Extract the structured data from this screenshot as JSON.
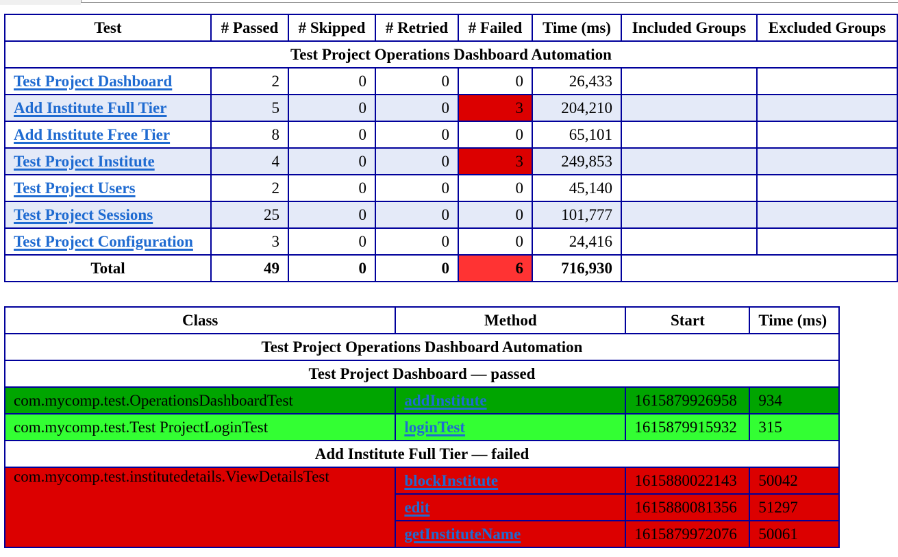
{
  "summary_table": {
    "headers": [
      "Test",
      "# Passed",
      "# Skipped",
      "# Retried",
      "# Failed",
      "Time (ms)",
      "Included Groups",
      "Excluded Groups"
    ],
    "suite_title": "Test Project Operations Dashboard Automation",
    "rows": [
      {
        "test": "Test Project Dashboard",
        "passed": "2",
        "skipped": "0",
        "retried": "0",
        "failed": "0",
        "time": "26,433",
        "included": "",
        "excluded": ""
      },
      {
        "test": "Add Institute Full Tier",
        "passed": "5",
        "skipped": "0",
        "retried": "0",
        "failed": "3",
        "time": "204,210",
        "included": "",
        "excluded": ""
      },
      {
        "test": "Add Institute Free Tier",
        "passed": "8",
        "skipped": "0",
        "retried": "0",
        "failed": "0",
        "time": "65,101",
        "included": "",
        "excluded": ""
      },
      {
        "test": "Test Project Institute",
        "passed": "4",
        "skipped": "0",
        "retried": "0",
        "failed": "3",
        "time": "249,853",
        "included": "",
        "excluded": ""
      },
      {
        "test": "Test Project Users",
        "passed": "2",
        "skipped": "0",
        "retried": "0",
        "failed": "0",
        "time": "45,140",
        "included": "",
        "excluded": ""
      },
      {
        "test": "Test Project Sessions",
        "passed": "25",
        "skipped": "0",
        "retried": "0",
        "failed": "0",
        "time": "101,777",
        "included": "",
        "excluded": ""
      },
      {
        "test": "Test Project Configuration",
        "passed": "3",
        "skipped": "0",
        "retried": "0",
        "failed": "0",
        "time": "24,416",
        "included": "",
        "excluded": ""
      }
    ],
    "total": {
      "label": "Total",
      "passed": "49",
      "skipped": "0",
      "retried": "0",
      "failed": "6",
      "time": "716,930"
    }
  },
  "methods_table": {
    "headers": [
      "Class",
      "Method",
      "Start",
      "Time (ms)"
    ],
    "suite_title": "Test Project Operations Dashboard Automation",
    "sections": [
      {
        "title": "Test Project Dashboard — passed",
        "rows": [
          {
            "class": "com.mycomp.test.OperationsDashboardTest",
            "method": "addInstitute",
            "start": "1615879926958",
            "time": "934"
          },
          {
            "class": "com.mycomp.test.Test ProjectLoginTest",
            "method": "loginTest",
            "start": "1615879915932",
            "time": "315"
          }
        ]
      },
      {
        "title": "Add Institute Full Tier — failed",
        "class": "com.mycomp.test.institutedetails.ViewDetailsTest",
        "rows": [
          {
            "method": "blockInstitute",
            "start": "1615880022143",
            "time": "50042"
          },
          {
            "method": "edit",
            "start": "1615880081356",
            "time": "51297"
          },
          {
            "method": "getInstituteName",
            "start": "1615879972076",
            "time": "50061"
          }
        ]
      }
    ]
  },
  "colors": {
    "border": "#00009b",
    "alt_row": "#e4eaf8",
    "failed_cell": "#dc0000",
    "failed_total": "#ff3333",
    "pass_dark": "#00a500",
    "pass_light": "#33ff33",
    "link": "#1f6bd1"
  }
}
